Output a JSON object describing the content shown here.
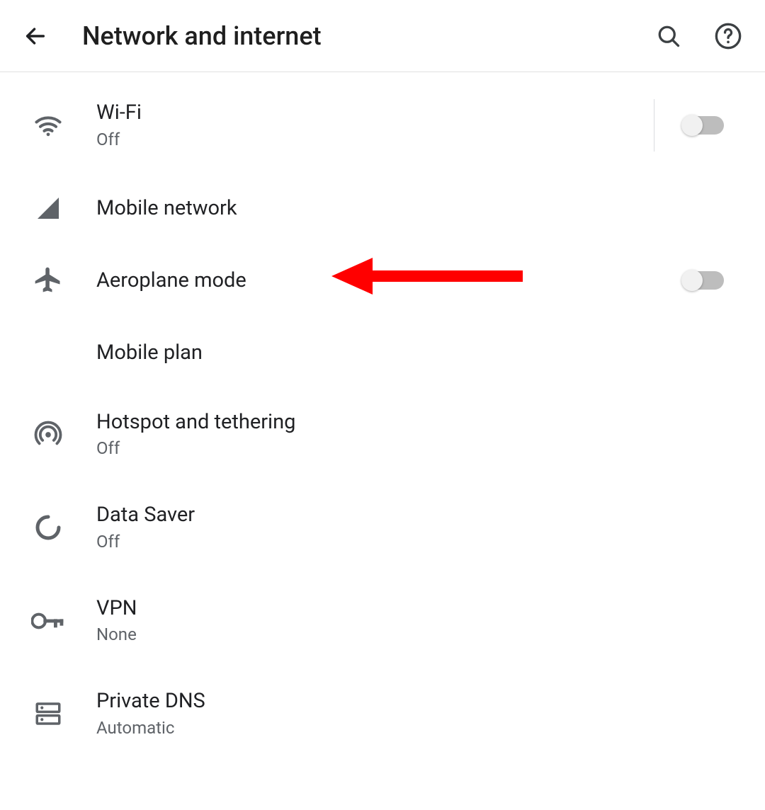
{
  "header": {
    "title": "Network and internet"
  },
  "items": [
    {
      "icon": "wifi-icon",
      "label": "Wi-Fi",
      "sub": "Off",
      "toggle": true,
      "divider": true
    },
    {
      "icon": "signal-icon",
      "label": "Mobile network"
    },
    {
      "icon": "airplane-icon",
      "label": "Aeroplane mode",
      "toggle": true
    },
    {
      "icon": "",
      "label": "Mobile plan"
    },
    {
      "icon": "hotspot-icon",
      "label": "Hotspot and tethering",
      "sub": "Off"
    },
    {
      "icon": "data-saver-icon",
      "label": "Data Saver",
      "sub": "Off"
    },
    {
      "icon": "vpn-icon",
      "label": "VPN",
      "sub": "None"
    },
    {
      "icon": "dns-icon",
      "label": "Private DNS",
      "sub": "Automatic"
    }
  ],
  "annotation": {
    "color": "#ff0000"
  }
}
